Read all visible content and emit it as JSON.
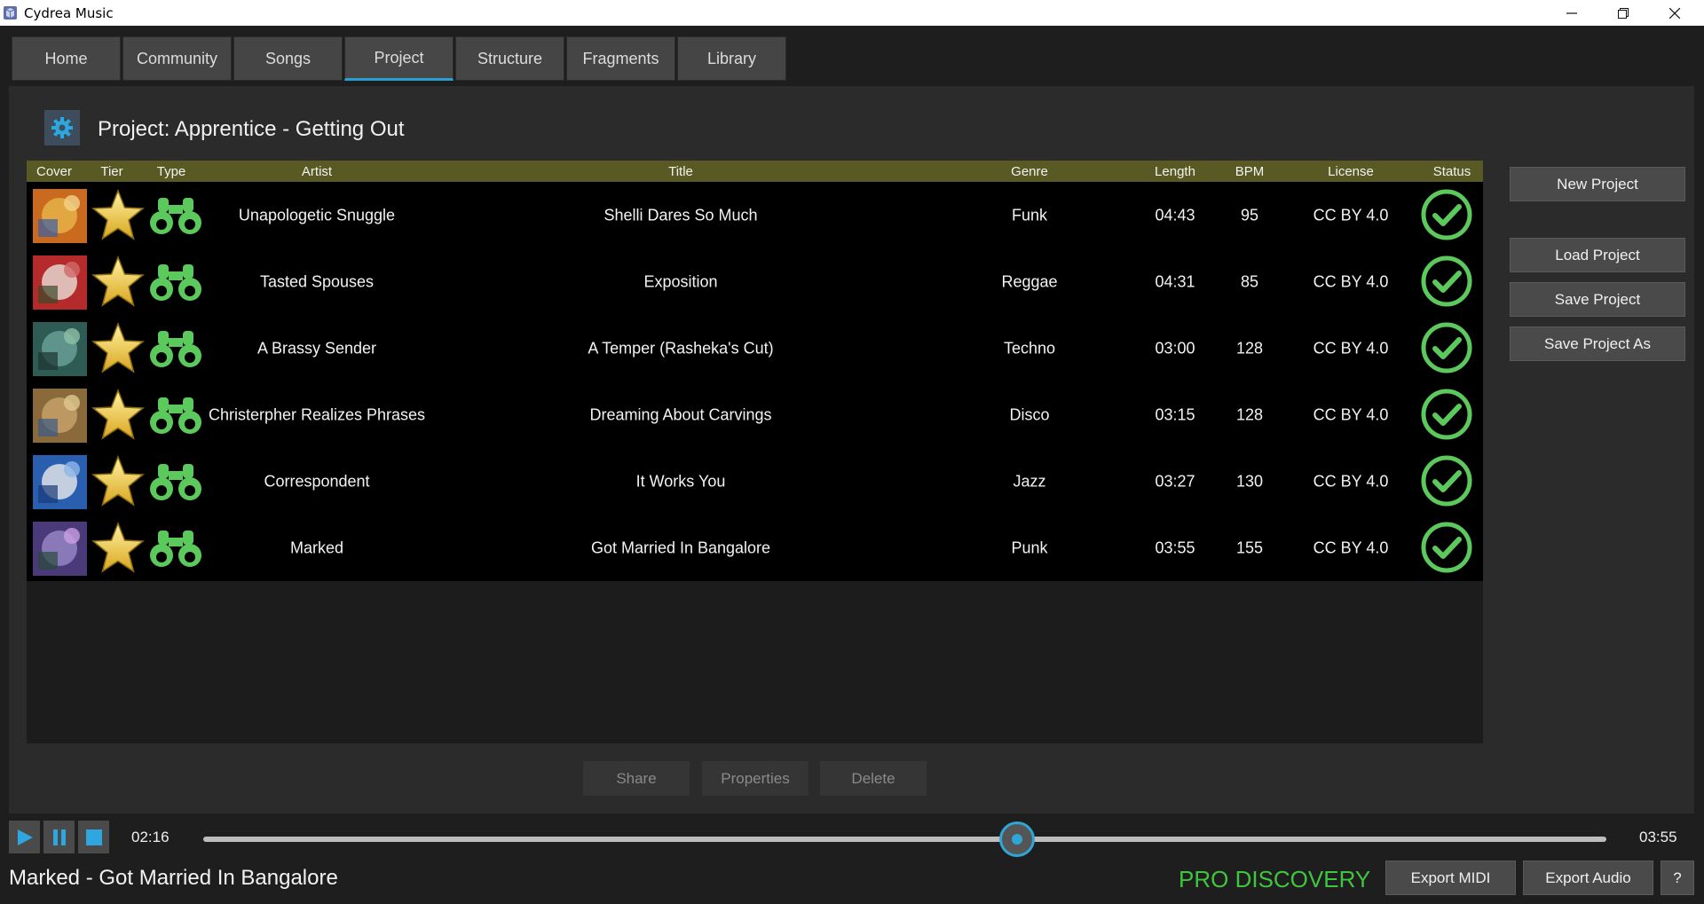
{
  "window": {
    "title": "Cydrea Music"
  },
  "tabs": [
    {
      "label": "Home"
    },
    {
      "label": "Community"
    },
    {
      "label": "Songs"
    },
    {
      "label": "Project",
      "active": true
    },
    {
      "label": "Structure"
    },
    {
      "label": "Fragments"
    },
    {
      "label": "Library"
    }
  ],
  "project": {
    "title": "Project: Apprentice - Getting Out"
  },
  "table": {
    "headers": {
      "cover": "Cover",
      "tier": "Tier",
      "type": "Type",
      "artist": "Artist",
      "title": "Title",
      "genre": "Genre",
      "length": "Length",
      "bpm": "BPM",
      "license": "License",
      "status": "Status"
    },
    "rows": [
      {
        "artist": "Unapologetic Snuggle",
        "title": "Shelli Dares So Much",
        "genre": "Funk",
        "length": "04:43",
        "bpm": "95",
        "license": "CC BY 4.0"
      },
      {
        "artist": "Tasted Spouses",
        "title": "Exposition",
        "genre": "Reggae",
        "length": "04:31",
        "bpm": "85",
        "license": "CC BY 4.0"
      },
      {
        "artist": "A Brassy Sender",
        "title": "A Temper (Rasheka's Cut)",
        "genre": "Techno",
        "length": "03:00",
        "bpm": "128",
        "license": "CC BY 4.0"
      },
      {
        "artist": "Christerpher Realizes Phrases",
        "title": "Dreaming About Carvings",
        "genre": "Disco",
        "length": "03:15",
        "bpm": "128",
        "license": "CC BY 4.0"
      },
      {
        "artist": "Correspondent",
        "title": "It Works You",
        "genre": "Jazz",
        "length": "03:27",
        "bpm": "130",
        "license": "CC BY 4.0"
      },
      {
        "artist": "Marked",
        "title": "Got Married In Bangalore",
        "genre": "Punk",
        "length": "03:55",
        "bpm": "155",
        "license": "CC BY 4.0"
      }
    ]
  },
  "side_buttons": {
    "new_project": "New Project",
    "load_project": "Load Project",
    "save_project": "Save Project",
    "save_project_as": "Save Project As"
  },
  "actions": {
    "share": "Share",
    "properties": "Properties",
    "delete": "Delete"
  },
  "player": {
    "current_time": "02:16",
    "total_time": "03:55",
    "progress": 0.58,
    "now_playing": "Marked - Got Married In Bangalore"
  },
  "footer": {
    "edition": "PRO DISCOVERY",
    "export_midi": "Export MIDI",
    "export_audio": "Export Audio",
    "help": "?"
  },
  "colors": {
    "accent": "#2a9fd6",
    "green": "#3ec73e",
    "header": "#595a23"
  }
}
